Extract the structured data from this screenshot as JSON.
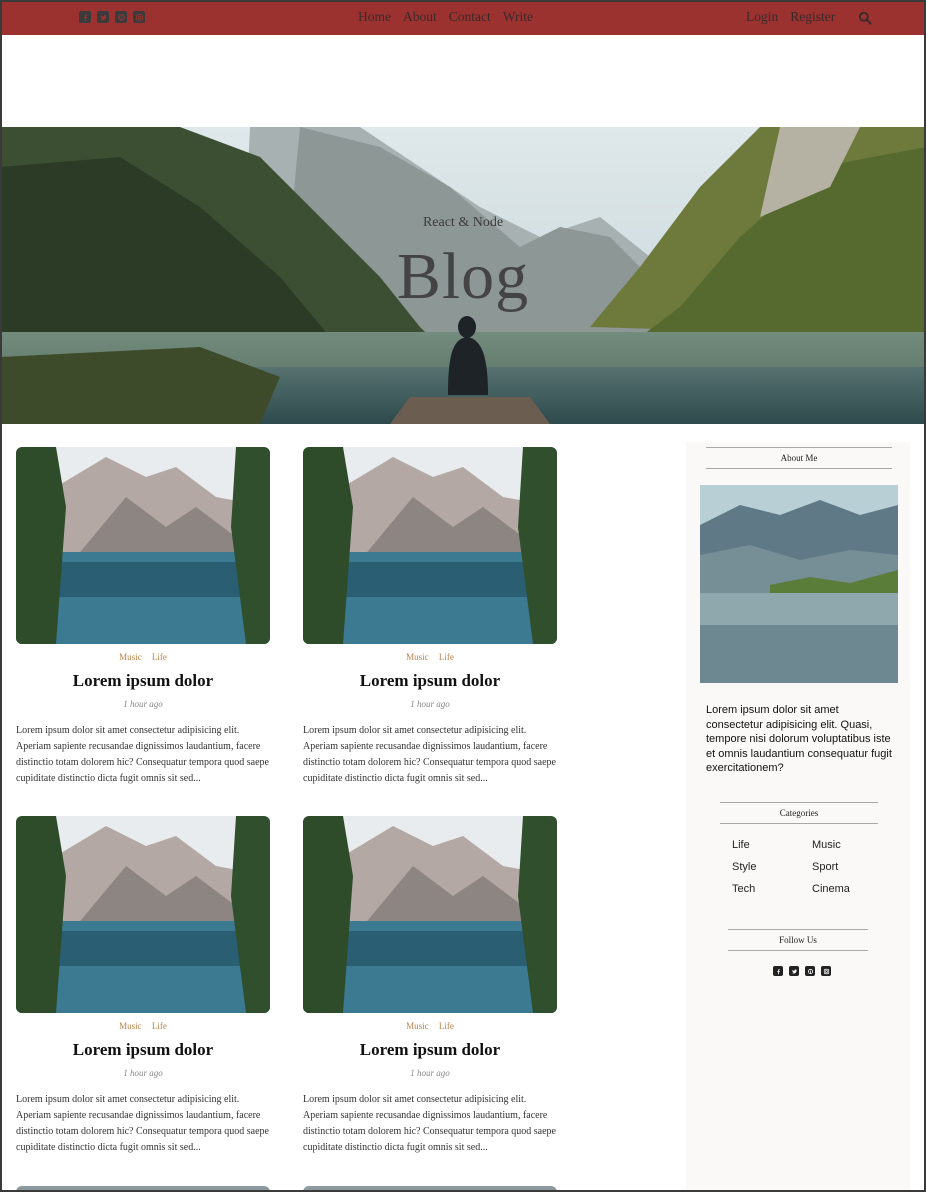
{
  "nav": {
    "social_icons": [
      "facebook-square-icon",
      "twitter-square-icon",
      "pinterest-square-icon",
      "instagram-square-icon"
    ],
    "links": [
      "Home",
      "About",
      "Contact",
      "Write"
    ],
    "auth": [
      "Login",
      "Register"
    ],
    "search_icon": "search-icon",
    "bar_color": "#9b3230"
  },
  "hero": {
    "subtitle": "React & Node",
    "title": "Blog"
  },
  "posts": [
    {
      "categories": [
        "Music",
        "Life"
      ],
      "title": "Lorem ipsum dolor",
      "date": "1 hour ago",
      "desc": "Lorem ipsum dolor sit amet consectetur adipisicing elit. Aperiam sapiente recusandae dignissimos laudantium, facere distinctio totam dolorem hic? Consequatur tempora quod saepe cupiditate distinctio dicta fugit omnis sit sed..."
    },
    {
      "categories": [
        "Music",
        "Life"
      ],
      "title": "Lorem ipsum dolor",
      "date": "1 hour ago",
      "desc": "Lorem ipsum dolor sit amet consectetur adipisicing elit. Aperiam sapiente recusandae dignissimos laudantium, facere distinctio totam dolorem hic? Consequatur tempora quod saepe cupiditate distinctio dicta fugit omnis sit sed..."
    },
    {
      "categories": [
        "Music",
        "Life"
      ],
      "title": "Lorem ipsum dolor",
      "date": "1 hour ago",
      "desc": "Lorem ipsum dolor sit amet consectetur adipisicing elit. Aperiam sapiente recusandae dignissimos laudantium, facere distinctio totam dolorem hic? Consequatur tempora quod saepe cupiditate distinctio dicta fugit omnis sit sed..."
    },
    {
      "categories": [
        "Music",
        "Life"
      ],
      "title": "Lorem ipsum dolor",
      "date": "1 hour ago",
      "desc": "Lorem ipsum dolor sit amet consectetur adipisicing elit. Aperiam sapiente recusandae dignissimos laudantium, facere distinctio totam dolorem hic? Consequatur tempora quod saepe cupiditate distinctio dicta fugit omnis sit sed..."
    }
  ],
  "sidebar": {
    "about_title": "About Me",
    "about_text": "Lorem ipsum dolor sit amet consectetur adipisicing elit. Quasi, tempore nisi dolorum voluptatibus iste et omnis laudantium consequatur fugit exercitationem?",
    "categories_title": "Categories",
    "categories": [
      "Life",
      "Music",
      "Style",
      "Sport",
      "Tech",
      "Cinema"
    ],
    "follow_title": "Follow Us",
    "follow_icons": [
      "facebook-square-icon",
      "twitter-square-icon",
      "pinterest-square-icon",
      "instagram-square-icon"
    ]
  },
  "colors": {
    "category_link": "#b8834a",
    "sidebar_bg": "#fbf8f8"
  }
}
